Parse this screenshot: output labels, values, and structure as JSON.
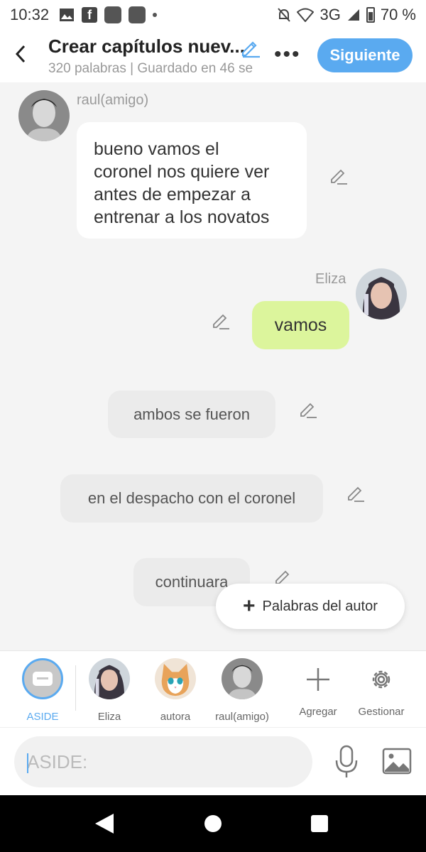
{
  "status_bar": {
    "time": "10:32",
    "network": "3G",
    "battery": "70 %"
  },
  "header": {
    "title": "Crear capítulos nuev...",
    "subtitle": "320 palabras | Guardado en 46 se",
    "next_label": "Siguiente"
  },
  "messages": [
    {
      "speaker": "raul(amigo)",
      "text_lines": [
        "bueno vamos el",
        "coronel nos quiere ver",
        "antes de empezar a",
        "entrenar a los novatos"
      ]
    },
    {
      "speaker": "Eliza",
      "text": "vamos"
    },
    {
      "speaker": "ASIDE",
      "text": "ambos se fueron"
    },
    {
      "speaker": "ASIDE",
      "text": "en el despacho con el coronel"
    },
    {
      "speaker": "ASIDE",
      "text": "continuara"
    }
  ],
  "add_author_words": "Palabras del autor",
  "characters": [
    {
      "label": "ASIDE",
      "selected": true
    },
    {
      "label": "Eliza"
    },
    {
      "label": "autora"
    },
    {
      "label": "raul(amigo)"
    }
  ],
  "char_actions": {
    "add_label": "Agregar",
    "manage_label": "Gestionar"
  },
  "input": {
    "placeholder": "ASIDE:"
  },
  "colors": {
    "accent": "#5aaaf0",
    "my_bubble": "#dcf59c",
    "other_bubble": "#ffffff",
    "aside_bubble": "#ebebeb"
  }
}
